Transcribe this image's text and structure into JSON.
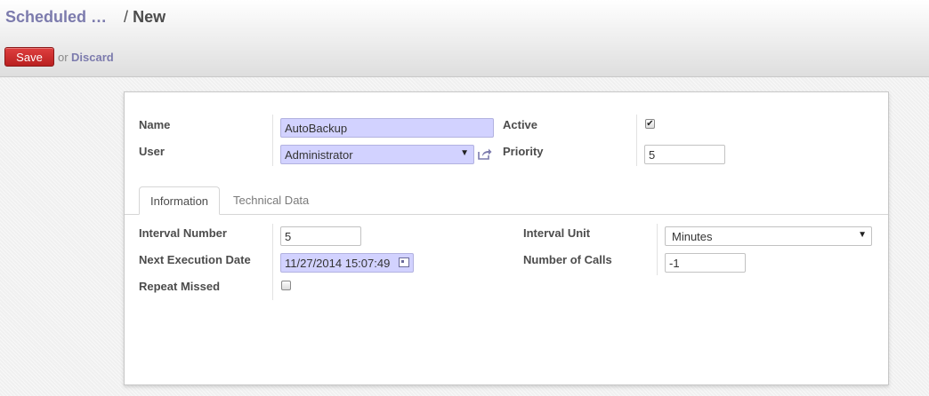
{
  "breadcrumb": {
    "parent": "Scheduled …",
    "separator": "/",
    "current": "New"
  },
  "toolbar": {
    "save_label": "Save",
    "or_text": "or",
    "discard_label": "Discard"
  },
  "form": {
    "name": {
      "label": "Name",
      "value": "AutoBackup"
    },
    "user": {
      "label": "User",
      "value": "Administrator"
    },
    "active": {
      "label": "Active",
      "checked": true,
      "check_glyph": "✔"
    },
    "priority": {
      "label": "Priority",
      "value": "5"
    }
  },
  "tabs": [
    {
      "label": "Information",
      "active": true
    },
    {
      "label": "Technical Data",
      "active": false
    }
  ],
  "information": {
    "interval_number": {
      "label": "Interval Number",
      "value": "5"
    },
    "next_execution_date": {
      "label": "Next Execution Date",
      "value": "11/27/2014 15:07:49"
    },
    "repeat_missed": {
      "label": "Repeat Missed",
      "checked": false
    },
    "interval_unit": {
      "label": "Interval Unit",
      "value": "Minutes"
    },
    "number_of_calls": {
      "label": "Number of Calls",
      "value": "-1"
    }
  },
  "icons": {
    "dropdown": "chevron-down-icon",
    "external": "external-link-icon",
    "calendar": "calendar-icon"
  },
  "colors": {
    "link": "#7c7bad",
    "save_button": "#c82828",
    "required_field": "#d2d2ff"
  }
}
